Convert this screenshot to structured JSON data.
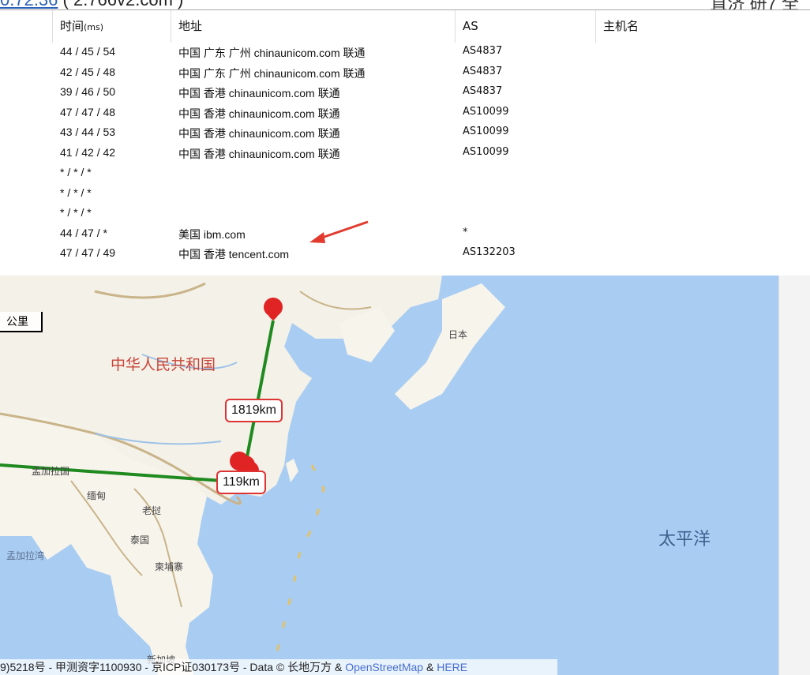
{
  "header": {
    "ip_partial": "0.72.36",
    "host_partial": "( 2.766v2.com )",
    "right_partial": "直济 研7 全"
  },
  "table": {
    "columns": {
      "time": "时间",
      "time_unit": "(ms)",
      "address": "地址",
      "as": "AS",
      "hostname": "主机名"
    },
    "rows": [
      {
        "time": "44 / 45 / 54",
        "address": "中国 广东 广州 chinaunicom.com 联通",
        "as": "AS4837",
        "host": ""
      },
      {
        "time": "42 / 45 / 48",
        "address": "中国 广东 广州 chinaunicom.com 联通",
        "as": "AS4837",
        "host": ""
      },
      {
        "time": "39 / 46 / 50",
        "address": "中国 香港 chinaunicom.com 联通",
        "as": "AS4837",
        "host": ""
      },
      {
        "time": "47 / 47 / 48",
        "address": "中国 香港 chinaunicom.com 联通",
        "as": "AS10099",
        "host": ""
      },
      {
        "time": "43 / 44 / 53",
        "address": "中国 香港 chinaunicom.com 联通",
        "as": "AS10099",
        "host": ""
      },
      {
        "time": "41 / 42 / 42",
        "address": "中国 香港 chinaunicom.com 联通",
        "as": "AS10099",
        "host": ""
      },
      {
        "time": "* / * / *",
        "address": "",
        "as": "",
        "host": ""
      },
      {
        "time": "* / * / *",
        "address": "",
        "as": "",
        "host": ""
      },
      {
        "time": "* / * / *",
        "address": "",
        "as": "",
        "host": ""
      },
      {
        "time": "44 / 47 / *",
        "address": "美国 ibm.com",
        "as": "*",
        "host": ""
      },
      {
        "time": "47 / 47 / 49",
        "address": "中国 香港 tencent.com",
        "as": "AS132203",
        "host": ""
      }
    ]
  },
  "map": {
    "scale_label": "公里",
    "distance_labels": [
      "1819km",
      "119km"
    ],
    "place_labels": {
      "china": "中华人民共和国",
      "japan": "日本",
      "pacific": "太平洋",
      "bangladesh": "孟加拉国",
      "myanmar": "缅甸",
      "laos": "老挝",
      "thailand": "泰国",
      "cambodia": "柬埔寨",
      "bay_of_bengal": "孟加拉湾",
      "singapore": "新加坡"
    },
    "attribution": {
      "text": "9)5218号 - 甲测资字1100930 - 京ICP证030173号 - Data © 长地万方 & ",
      "osm": "OpenStreetMap",
      "amp": " & ",
      "here": "HERE"
    },
    "route_color": "#1f8a1f",
    "marker_color": "#e02424"
  }
}
